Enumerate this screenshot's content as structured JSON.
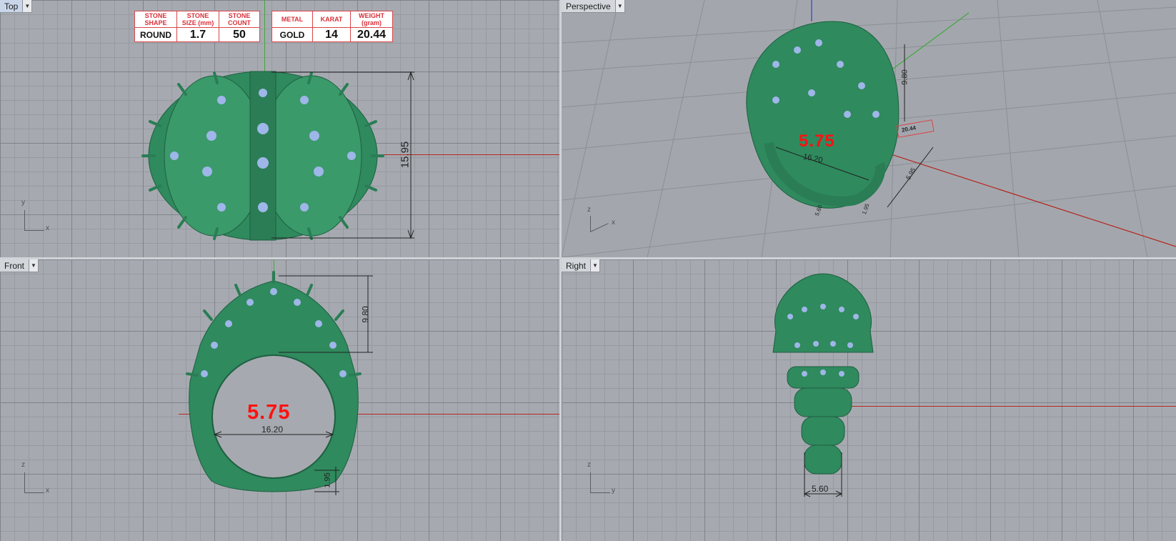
{
  "viewports": {
    "top": {
      "label": "Top",
      "axis_h": "x",
      "axis_v": "y"
    },
    "perspective": {
      "label": "Perspective",
      "axis_h": "x",
      "axis_v": "z"
    },
    "front": {
      "label": "Front",
      "axis_h": "x",
      "axis_v": "z"
    },
    "right": {
      "label": "Right",
      "axis_h": "y",
      "axis_v": "z"
    }
  },
  "stone_table": {
    "headers": [
      "STONE SHAPE",
      "STONE SIZE (mm)",
      "STONE COUNT"
    ],
    "values": [
      "ROUND",
      "1.7",
      "50"
    ]
  },
  "metal_table": {
    "headers": [
      "METAL",
      "KARAT",
      "WEIGHT (gram)"
    ],
    "values": [
      "GOLD",
      "14",
      "20.44"
    ]
  },
  "dimensions": {
    "top_height": "15.95",
    "persp_height": "9.80",
    "persp_width": "16.20",
    "persp_weight": "20.44",
    "persp_small_a": "5.95",
    "persp_small_b": "1.95",
    "persp_small_c": "5.60",
    "front_height": "9.80",
    "front_width": "16.20",
    "front_bottom": "1.95",
    "right_width": "5.60"
  },
  "ring_size": {
    "top": "5.75",
    "front": "5.75"
  },
  "colors": {
    "model": "#2f8a5e",
    "stone": "#9fb6e8",
    "axis_x": "#b5261f",
    "axis_y": "#3fa83c",
    "axis_z": "#3b3bc7",
    "ring_size_text": "#ff1111"
  }
}
